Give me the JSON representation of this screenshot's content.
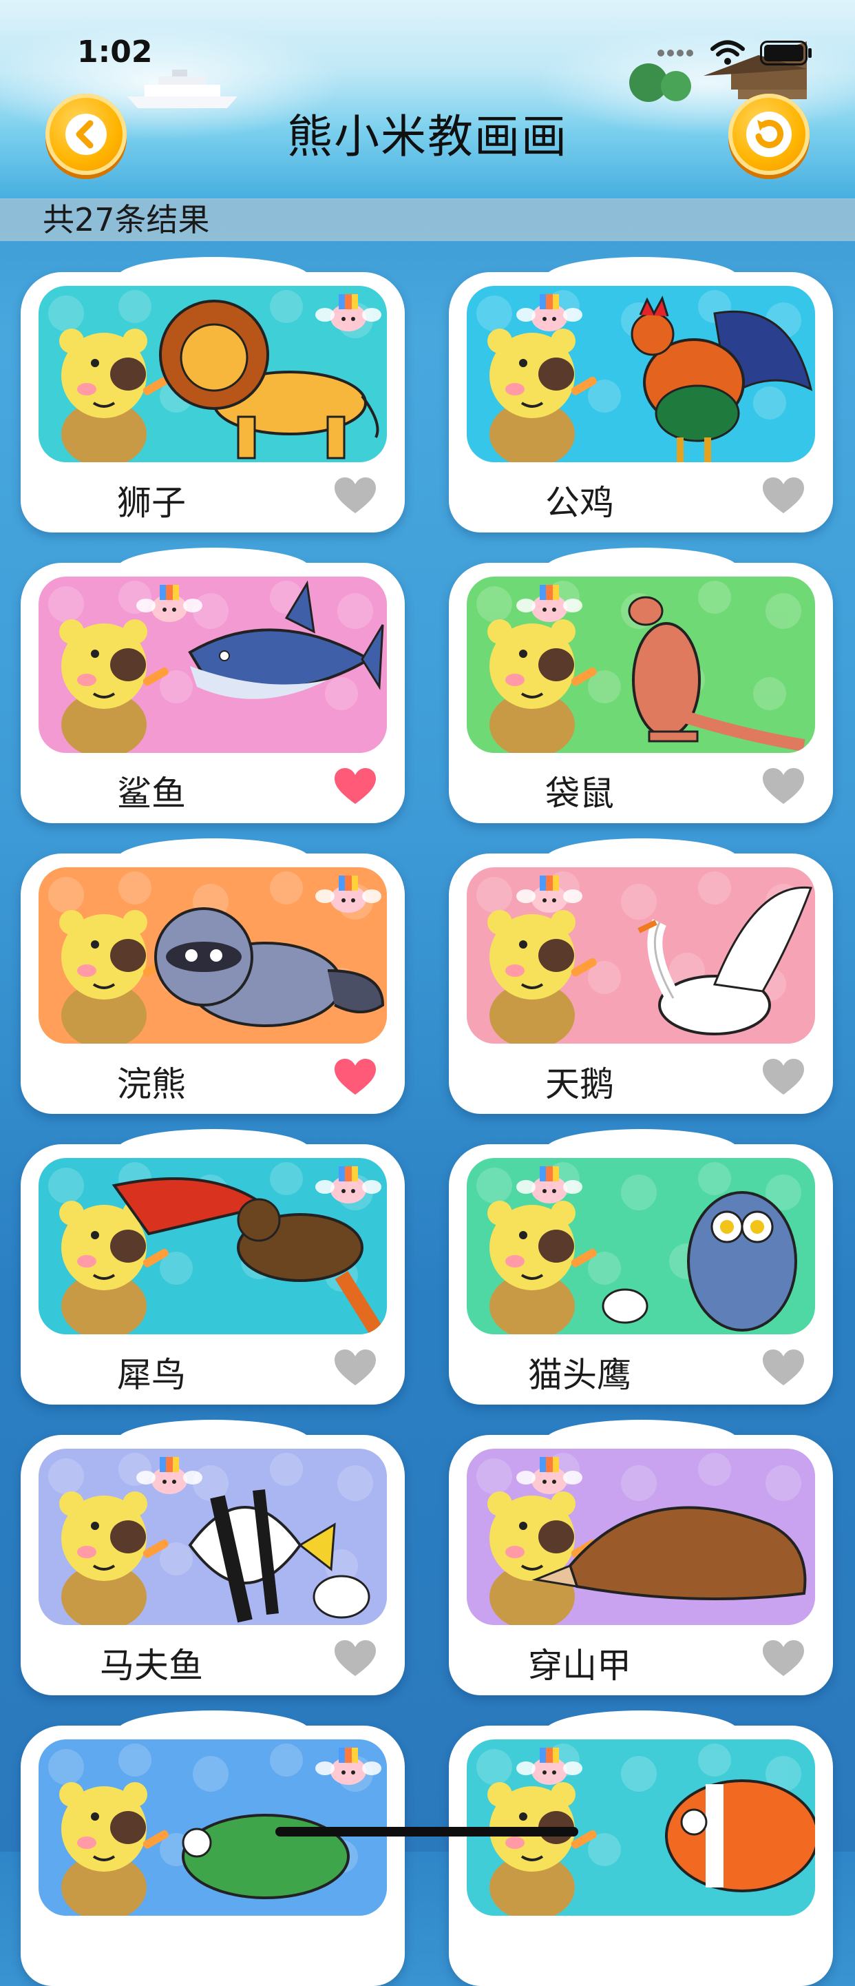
{
  "status_bar": {
    "time": "1:02"
  },
  "header": {
    "title": "熊小米教画画",
    "back_icon": "chevron-left-icon",
    "refresh_icon": "refresh-icon"
  },
  "results": {
    "text": "共27条结果"
  },
  "colors": {
    "heart_active": "#ff5a78",
    "heart_inactive": "#b9b9b9",
    "button_orange": "#ffb400"
  },
  "cards": [
    {
      "label": "狮子",
      "bg": "#3fcfd6",
      "favorited": false,
      "animal": "lion"
    },
    {
      "label": "公鸡",
      "bg": "#35c6ea",
      "favorited": false,
      "animal": "rooster"
    },
    {
      "label": "鲨鱼",
      "bg": "#f49ad2",
      "favorited": true,
      "animal": "shark"
    },
    {
      "label": "袋鼠",
      "bg": "#6fd975",
      "favorited": false,
      "animal": "kangaroo"
    },
    {
      "label": "浣熊",
      "bg": "#ff9f5a",
      "favorited": true,
      "animal": "raccoon"
    },
    {
      "label": "天鹅",
      "bg": "#f6a3b5",
      "favorited": false,
      "animal": "swan"
    },
    {
      "label": "犀鸟",
      "bg": "#36c7d8",
      "favorited": false,
      "animal": "hornbill"
    },
    {
      "label": "猫头鹰",
      "bg": "#4fd8a3",
      "favorited": false,
      "animal": "owl"
    },
    {
      "label": "马夫鱼",
      "bg": "#a9b6f2",
      "favorited": false,
      "animal": "bannerfish"
    },
    {
      "label": "穿山甲",
      "bg": "#c9a3ef",
      "favorited": false,
      "animal": "pangolin"
    },
    {
      "label": "",
      "bg": "#5fa9f0",
      "favorited": false,
      "animal": "chameleon"
    },
    {
      "label": "",
      "bg": "#40cdd8",
      "favorited": false,
      "animal": "clownfish"
    }
  ]
}
